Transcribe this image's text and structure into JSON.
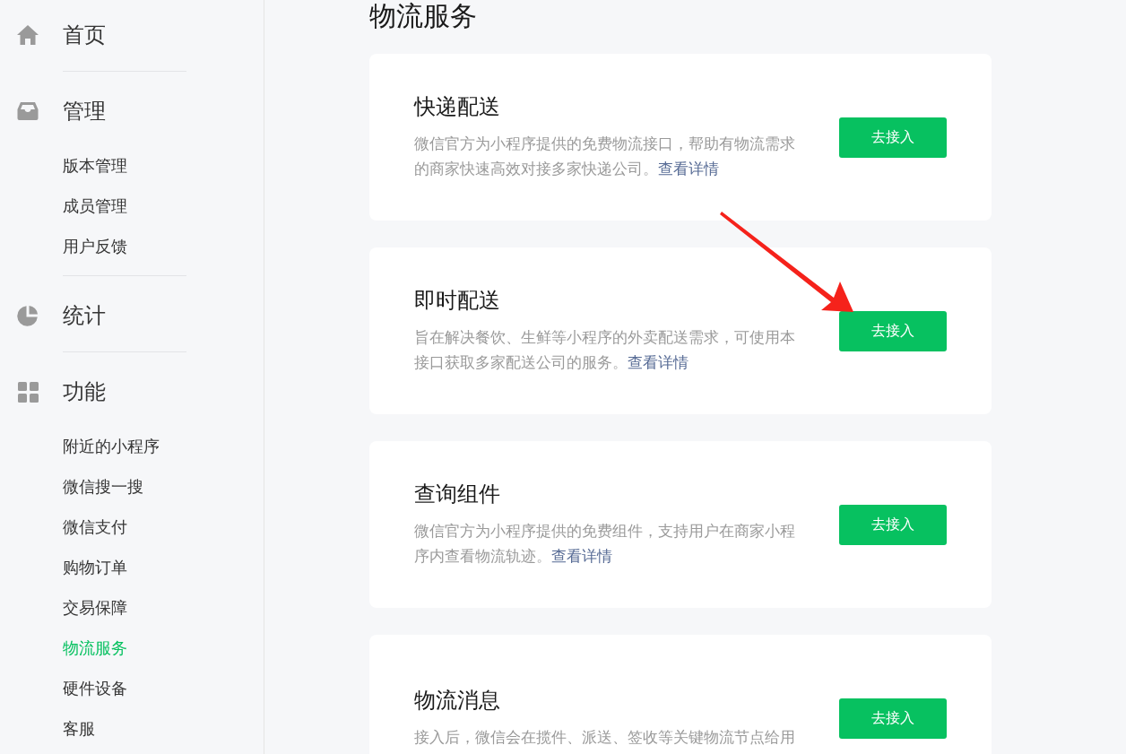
{
  "sidebar": {
    "sections": [
      {
        "label": "首页"
      },
      {
        "label": "管理",
        "items": [
          {
            "label": "版本管理",
            "selected": false
          },
          {
            "label": "成员管理",
            "selected": false
          },
          {
            "label": "用户反馈",
            "selected": false
          }
        ]
      },
      {
        "label": "统计"
      },
      {
        "label": "功能",
        "items": [
          {
            "label": "附近的小程序",
            "selected": false
          },
          {
            "label": "微信搜一搜",
            "selected": false
          },
          {
            "label": "微信支付",
            "selected": false
          },
          {
            "label": "购物订单",
            "selected": false
          },
          {
            "label": "交易保障",
            "selected": false
          },
          {
            "label": "物流服务",
            "selected": true
          },
          {
            "label": "硬件设备",
            "selected": false
          },
          {
            "label": "客服",
            "selected": false
          }
        ]
      }
    ]
  },
  "heading": "物流服务",
  "services": [
    {
      "title": "快递配送",
      "description": "微信官方为小程序提供的免费物流接口，帮助有物流需求的商家快速高效对接多家快递公司。",
      "link": "查看详情",
      "button": "去接入"
    },
    {
      "title": "即时配送",
      "description": "旨在解决餐饮、生鲜等小程序的外卖配送需求，可使用本接口获取多家配送公司的服务。",
      "link": "查看详情",
      "button": "去接入"
    },
    {
      "title": "查询组件",
      "description": "微信官方为小程序提供的免费组件，支持用户在商家小程序内查看物流轨迹。",
      "link": "查看详情",
      "button": "去接入"
    },
    {
      "title": "物流消息",
      "description": "接入后，微信会在揽件、派送、签收等关键物流节点给用",
      "button": "去接入"
    }
  ]
}
